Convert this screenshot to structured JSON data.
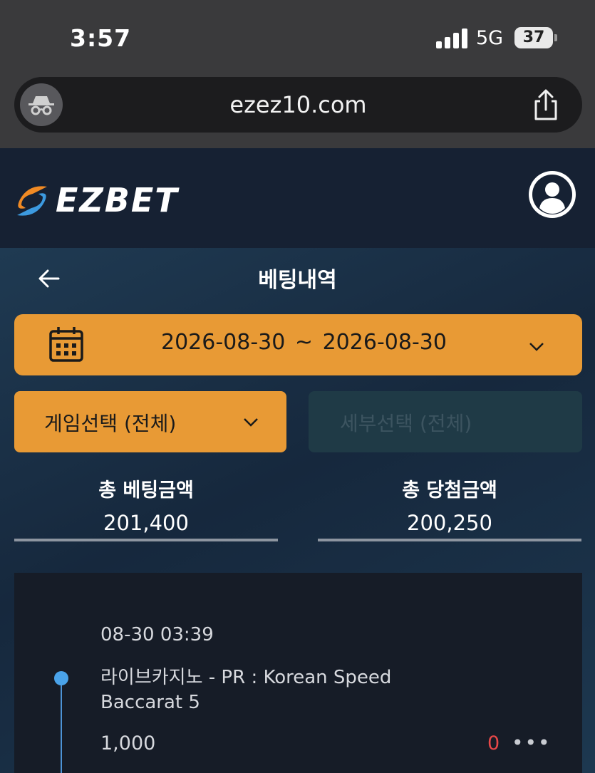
{
  "status_bar": {
    "time": "3:57",
    "network": "5G",
    "battery": "37"
  },
  "browser": {
    "url": "ezez10.com"
  },
  "header": {
    "logo_text": "EZBET"
  },
  "page": {
    "title": "베팅내역"
  },
  "date_range": {
    "start": "2026-08-30",
    "separator": "~",
    "end": "2026-08-30"
  },
  "filters": {
    "game_select": "게임선택 (전체)",
    "detail_select": "세부선택 (전체)"
  },
  "summary": {
    "bet_label": "총 베팅금액",
    "bet_value": "201,400",
    "win_label": "총 당첨금액",
    "win_value": "200,250"
  },
  "bets": [
    {
      "timestamp": "08-30 03:39",
      "game_line1": "라이브카지노 - PR : Korean Speed",
      "game_line2": "Baccarat 5",
      "amount": "1,000",
      "win": "0",
      "more": "•••"
    }
  ],
  "colors": {
    "accent": "#e89a35",
    "timeline": "#4aa3ea",
    "loss": "#e84848"
  }
}
